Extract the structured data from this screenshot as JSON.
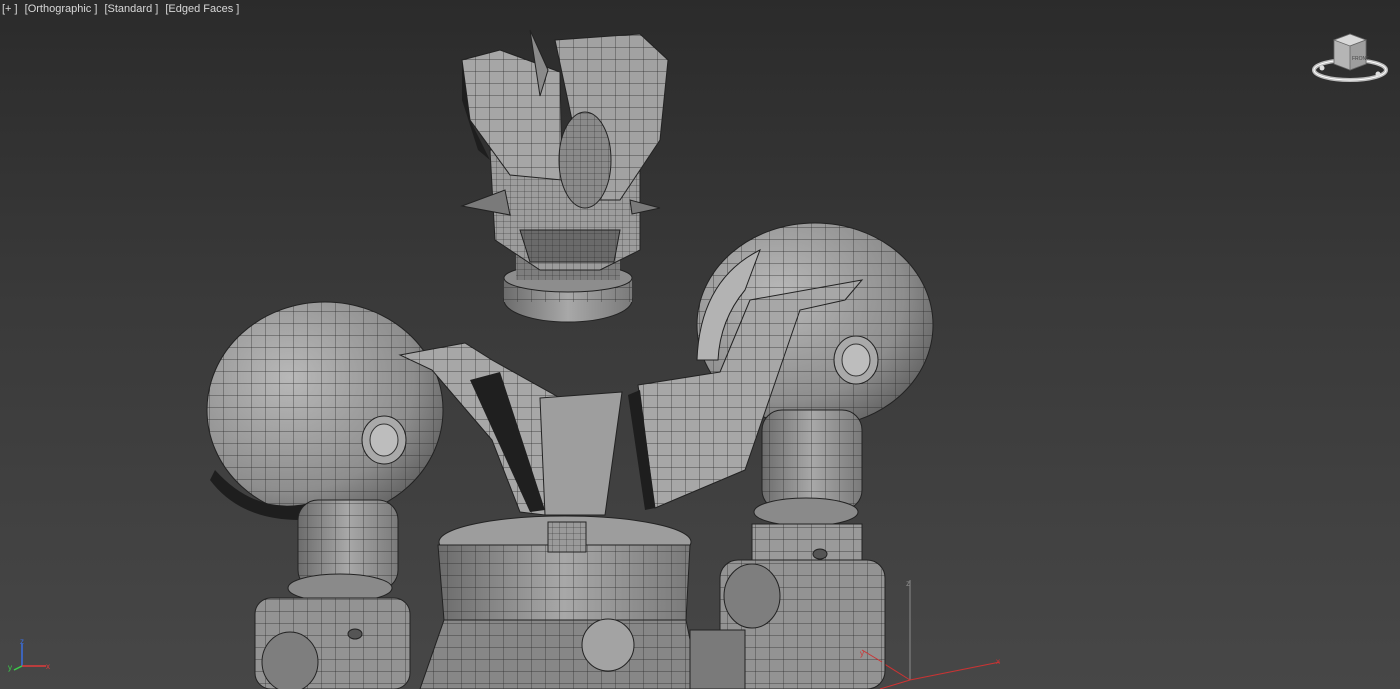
{
  "viewport": {
    "labels": {
      "plus": "[+ ]",
      "view": "[Orthographic ]",
      "shading": "[Standard ]",
      "display_mode": "[Edged Faces ]"
    }
  },
  "viewcube": {
    "face_label": "FRONT",
    "icon": "viewcube-icon"
  },
  "axis_tripod": {
    "x_label": "x",
    "y_label": "y",
    "z_label": "z",
    "x_color": "#e03a3a",
    "y_color": "#3ad04a",
    "z_color": "#3a6fe0"
  },
  "scene": {
    "grid_axis_color_x": "#cc3333",
    "grid_axis_color_y": "#cc3333",
    "mesh_color": "#9a9a9a",
    "wire_color": "#222222"
  }
}
